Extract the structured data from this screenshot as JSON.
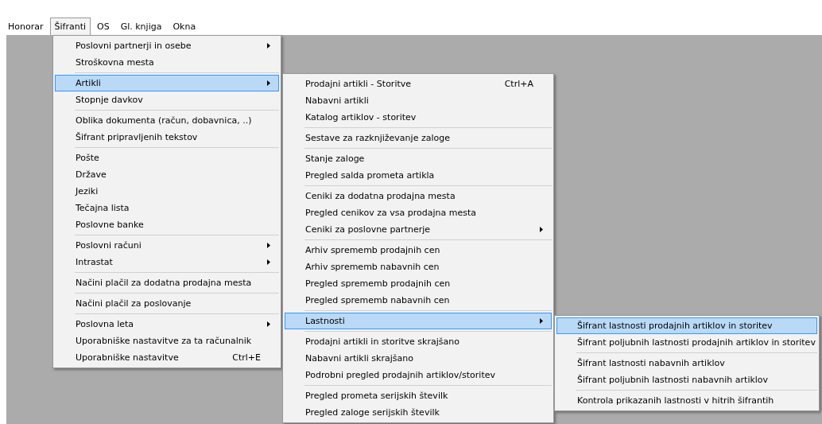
{
  "menu_bar": [
    {
      "label": "Honorar",
      "selected": false
    },
    {
      "label": "Šifranti",
      "selected": true
    },
    {
      "label": "OS",
      "selected": false
    },
    {
      "label": "Gl. knjiga",
      "selected": false
    },
    {
      "label": "Okna",
      "selected": false
    }
  ],
  "menus": [
    {
      "items": [
        {
          "kind": "item",
          "label": "Poslovni partnerji in osebe",
          "submenu": true,
          "selected": false
        },
        {
          "kind": "item",
          "label": "Stroškovna mesta",
          "submenu": false,
          "selected": false
        },
        {
          "kind": "separator"
        },
        {
          "kind": "item",
          "label": "Artikli",
          "submenu": true,
          "selected": true
        },
        {
          "kind": "item",
          "label": "Stopnje davkov",
          "submenu": false,
          "selected": false
        },
        {
          "kind": "separator"
        },
        {
          "kind": "item",
          "label": "Oblika dokumenta (račun, dobavnica, ..)",
          "submenu": false,
          "selected": false
        },
        {
          "kind": "item",
          "label": "Šifrant pripravljenih tekstov",
          "submenu": false,
          "selected": false
        },
        {
          "kind": "separator"
        },
        {
          "kind": "item",
          "label": "Pošte",
          "submenu": false,
          "selected": false
        },
        {
          "kind": "item",
          "label": "Države",
          "submenu": false,
          "selected": false
        },
        {
          "kind": "item",
          "label": "Jeziki",
          "submenu": false,
          "selected": false
        },
        {
          "kind": "item",
          "label": "Tečajna lista",
          "submenu": false,
          "selected": false
        },
        {
          "kind": "item",
          "label": "Poslovne banke",
          "submenu": false,
          "selected": false
        },
        {
          "kind": "separator"
        },
        {
          "kind": "item",
          "label": "Poslovni računi",
          "submenu": true,
          "selected": false
        },
        {
          "kind": "item",
          "label": "Intrastat",
          "submenu": true,
          "selected": false
        },
        {
          "kind": "separator"
        },
        {
          "kind": "item",
          "label": "Načini plačil za dodatna prodajna mesta",
          "submenu": false,
          "selected": false
        },
        {
          "kind": "separator"
        },
        {
          "kind": "item",
          "label": "Načini plačil za poslovanje",
          "submenu": false,
          "selected": false
        },
        {
          "kind": "separator"
        },
        {
          "kind": "item",
          "label": "Poslovna leta",
          "submenu": true,
          "selected": false
        },
        {
          "kind": "item",
          "label": "Uporabniške nastavitve za ta računalnik",
          "submenu": false,
          "selected": false
        },
        {
          "kind": "item",
          "label": "Uporabniške nastavitve",
          "shortcut": "Ctrl+E",
          "submenu": false,
          "selected": false
        }
      ]
    },
    {
      "items": [
        {
          "kind": "item",
          "label": "Prodajni artikli - Storitve",
          "shortcut": "Ctrl+A",
          "submenu": false,
          "selected": false
        },
        {
          "kind": "item",
          "label": "Nabavni artikli",
          "submenu": false,
          "selected": false
        },
        {
          "kind": "item",
          "label": "Katalog artiklov - storitev",
          "submenu": false,
          "selected": false
        },
        {
          "kind": "separator"
        },
        {
          "kind": "item",
          "label": "Sestave za razknjiževanje zaloge",
          "submenu": false,
          "selected": false
        },
        {
          "kind": "separator"
        },
        {
          "kind": "item",
          "label": "Stanje zaloge",
          "submenu": false,
          "selected": false
        },
        {
          "kind": "item",
          "label": "Pregled salda prometa artikla",
          "submenu": false,
          "selected": false
        },
        {
          "kind": "separator"
        },
        {
          "kind": "item",
          "label": "Ceniki za dodatna prodajna mesta",
          "submenu": false,
          "selected": false
        },
        {
          "kind": "item",
          "label": "Pregled cenikov za vsa prodajna mesta",
          "submenu": false,
          "selected": false
        },
        {
          "kind": "item",
          "label": "Ceniki za poslovne partnerje",
          "submenu": true,
          "selected": false
        },
        {
          "kind": "separator"
        },
        {
          "kind": "item",
          "label": "Arhiv sprememb prodajnih cen",
          "submenu": false,
          "selected": false
        },
        {
          "kind": "item",
          "label": "Arhiv sprememb nabavnih cen",
          "submenu": false,
          "selected": false
        },
        {
          "kind": "item",
          "label": "Pregled sprememb prodajnih cen",
          "submenu": false,
          "selected": false
        },
        {
          "kind": "item",
          "label": "Pregled sprememb nabavnih cen",
          "submenu": false,
          "selected": false
        },
        {
          "kind": "separator"
        },
        {
          "kind": "item",
          "label": "Lastnosti",
          "submenu": true,
          "selected": true
        },
        {
          "kind": "separator"
        },
        {
          "kind": "item",
          "label": "Prodajni artikli in storitve skrajšano",
          "submenu": false,
          "selected": false
        },
        {
          "kind": "item",
          "label": "Nabavni artikli skrajšano",
          "submenu": false,
          "selected": false
        },
        {
          "kind": "item",
          "label": "Podrobni pregled prodajnih artiklov/storitev",
          "submenu": false,
          "selected": false
        },
        {
          "kind": "separator"
        },
        {
          "kind": "item",
          "label": "Pregled prometa serijskih številk",
          "submenu": false,
          "selected": false
        },
        {
          "kind": "item",
          "label": "Pregled zaloge serijskih številk",
          "submenu": false,
          "selected": false
        }
      ]
    },
    {
      "items": [
        {
          "kind": "item",
          "label": "Šifrant lastnosti prodajnih artiklov in storitev",
          "submenu": false,
          "selected": true
        },
        {
          "kind": "item",
          "label": "Šifrant poljubnih lastnosti prodajnih artiklov in storitev",
          "submenu": false,
          "selected": false
        },
        {
          "kind": "separator"
        },
        {
          "kind": "item",
          "label": "Šifrant lastnosti nabavnih artiklov",
          "submenu": false,
          "selected": false
        },
        {
          "kind": "item",
          "label": "Šifrant poljubnih lastnosti nabavnih artiklov",
          "submenu": false,
          "selected": false
        },
        {
          "kind": "separator"
        },
        {
          "kind": "item",
          "label": "Kontrola prikazanih lastnosti v hitrih šifrantih",
          "submenu": false,
          "selected": false
        }
      ]
    }
  ]
}
